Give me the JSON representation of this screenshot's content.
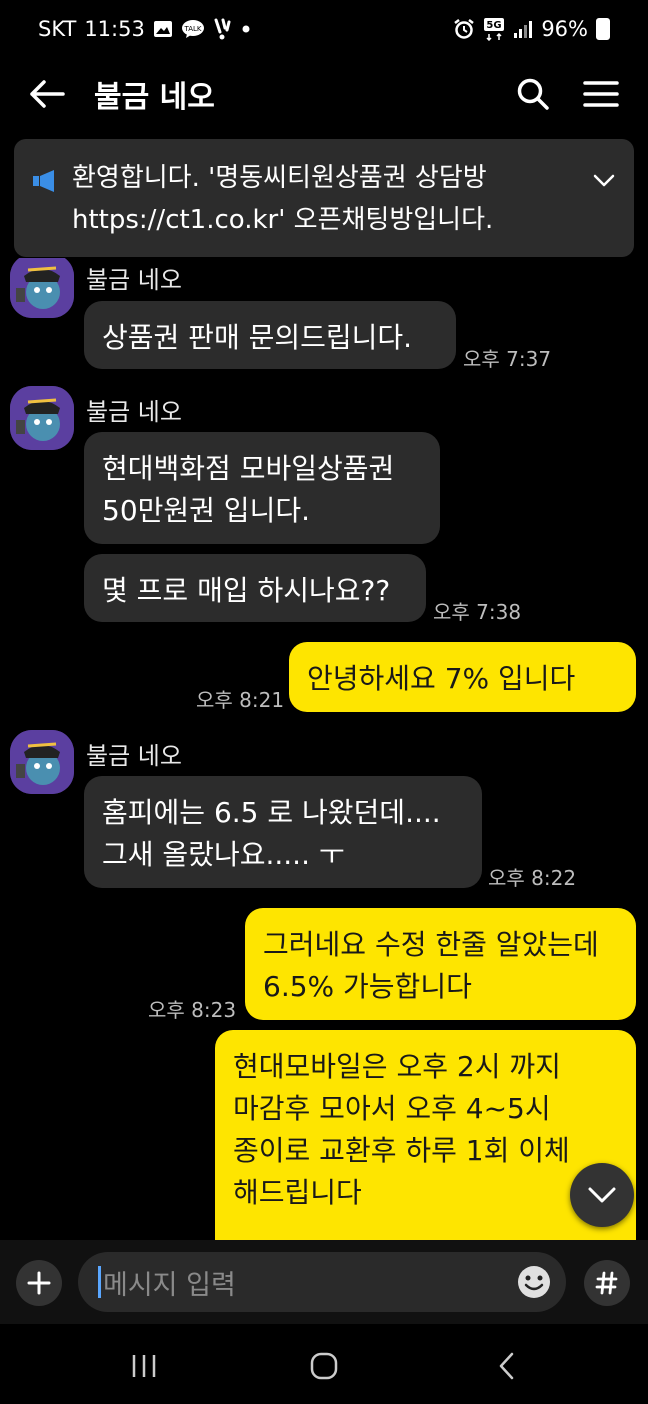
{
  "status_bar": {
    "carrier": "SKT",
    "time": "11:53",
    "talk_badge": "TALK",
    "network": "5G",
    "battery": "96%"
  },
  "header": {
    "title": "불금 네오"
  },
  "notice": {
    "line1": "환영합니다. '명동씨티원상품권 상담방",
    "line2": "https://ct1.co.kr' 오픈채팅방입니다."
  },
  "messages": {
    "m1": {
      "sender": "불금 네오",
      "text": "상품권 판매 문의드립니다.",
      "time": "오후 7:37"
    },
    "m2": {
      "sender": "불금 네오",
      "line1": "현대백화점 모바일상품권",
      "line2": "50만원권 입니다."
    },
    "m3": {
      "text": "몇 프로 매입 하시나요??",
      "time": "오후 7:38"
    },
    "m4": {
      "text": "안녕하세요   7%  입니다",
      "time": "오후 8:21"
    },
    "m5": {
      "sender": "불금 네오",
      "line1": "홈피에는 6.5 로 나왔던데....",
      "line2": "그새 올랐나요..... ㅜ",
      "time": "오후 8:22"
    },
    "m6": {
      "line1": "그러네요 수정 한줄 알았는데",
      "line2": "6.5%  가능합니다",
      "time": "오후 8:23"
    },
    "m7": {
      "line1": "현대모바일은 오후 2시 까지",
      "line2": "마감후  모아서 오후 4~5시",
      "line3": "종이로 교환후  하루  1회  이체",
      "line4": "해드립니다"
    }
  },
  "composer": {
    "placeholder": "메시지 입력"
  },
  "icons": {
    "back": "arrow-left-icon",
    "search": "search-icon",
    "menu": "menu-icon",
    "notice": "megaphone-icon",
    "expand": "chevron-down-icon",
    "scroll_down": "chevron-down-icon",
    "plus": "plus-icon",
    "emoji": "emoji-icon",
    "hash": "hashtag-icon"
  },
  "colors": {
    "outgoing_bubble": "#fee500",
    "incoming_bubble": "#2c2c2c",
    "background": "#000000",
    "notice_icon": "#3a8ee6"
  }
}
